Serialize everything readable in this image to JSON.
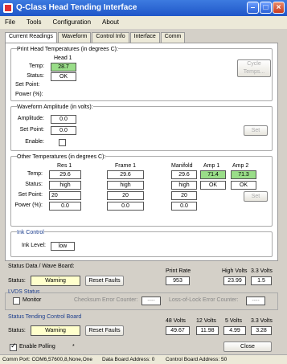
{
  "window": {
    "title": "Q-Class Head Tending Interface"
  },
  "menu": [
    "File",
    "Tools",
    "Configuration",
    "About"
  ],
  "tabs": [
    "Current Readings",
    "Waveform",
    "Control Info",
    "Interface",
    "Comm"
  ],
  "print_head": {
    "title": "Print Head Temperatures (in degrees C):",
    "col": "Head 1",
    "temp_label": "Temp:",
    "temp": "28.7",
    "status_label": "Status:",
    "status": "OK",
    "setpoint_label": "Set Point:",
    "power_label": "Power (%):",
    "cycle_btn_line1": "Cycle",
    "cycle_btn_line2": "Temps..."
  },
  "waveform": {
    "title": "Waveform Amplitude (in volts):",
    "amplitude_label": "Amplitude:",
    "amplitude": "0.0",
    "setpoint_label": "Set Point:",
    "setpoint": "0.0",
    "enable_label": "Enable:",
    "set_btn": "Set"
  },
  "other_temps": {
    "title": "Other Temperatures (in degrees C):",
    "cols": {
      "res1": "Res 1",
      "frame1": "Frame 1",
      "manifold": "Manifold",
      "amp1": "Amp 1",
      "amp2": "Amp 2"
    },
    "temp_label": "Temp:",
    "status_label": "Status:",
    "setpoint_label": "Set Point:",
    "power_label": "Power (%):",
    "res1": {
      "temp": "29.6",
      "status": "high",
      "setpoint": "20",
      "power": "0.0"
    },
    "frame1": {
      "temp": "29.6",
      "status": "high",
      "setpoint": "20",
      "power": "0.0"
    },
    "manifold": {
      "temp": "29.6",
      "status": "high",
      "setpoint": "20",
      "power": "0.0"
    },
    "amp1": {
      "temp": "71.4",
      "status": "OK"
    },
    "amp2": {
      "temp": "71.3",
      "status": "OK"
    },
    "set_btn": "Set"
  },
  "ink": {
    "title": "Ink Control",
    "level_label": "Ink Level:",
    "level": "low"
  },
  "status_wave": {
    "title": "Status Data / Wave Board:",
    "status_label": "Status:",
    "status": "Warning",
    "reset_btn": "Reset Faults",
    "print_rate_label": "Print Rate",
    "print_rate": "953",
    "high_volts_label": "High Volts",
    "high_volts": "23.99",
    "v33_label": "3.3 Volts",
    "v33": "1.5"
  },
  "lvds": {
    "title": "LVDS Status",
    "monitor_label": "Monitor",
    "checksum_label": "Checksum Error Counter:",
    "checksum": "----",
    "loss_label": "Loss-of-Lock Error Counter:",
    "loss": "----"
  },
  "control_board": {
    "title": "Status Tending Control Board",
    "status_label": "Status:",
    "status": "Warning",
    "reset_btn": "Reset Faults",
    "v48_label": "48 Volts",
    "v48": "49.67",
    "v12_label": "12 Volts",
    "v12": "11.98",
    "v5_label": "5 Volts",
    "v5": "4.99",
    "v33_label": "3.3 Volts",
    "v33": "3.28"
  },
  "footer": {
    "polling_label": "Enable Polling",
    "polling_mark": "*",
    "close_btn": "Close"
  },
  "statusbar": {
    "port": "Comm Port: COM6,57600,8,None,One",
    "data_board": "Data Board Address: 0",
    "control_board": "Control Board Address: 50"
  }
}
